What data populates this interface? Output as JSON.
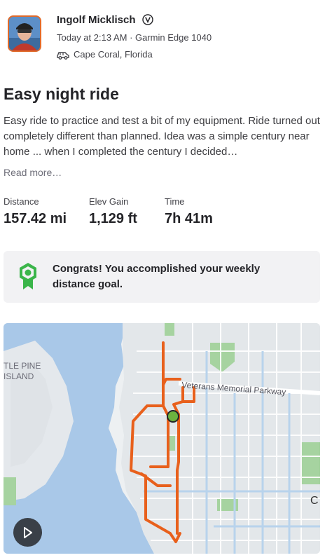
{
  "header": {
    "athlete_name": "Ingolf Micklisch",
    "verified_glyph": "Ⓥ",
    "meta": "Today at 2:13 AM · Garmin Edge 1040",
    "location": "Cape Coral, Florida",
    "location_icon": "car-icon",
    "avatar_icon": "avatar"
  },
  "activity": {
    "title": "Easy night ride",
    "description": "Easy ride to practice and test a bit of my equipment. Ride turned out completely different than planned. Idea was a simple century near home ... when I completed the century I decided…",
    "read_more": "Read more…"
  },
  "stats": [
    {
      "label": "Distance",
      "value": "157.42 mi"
    },
    {
      "label": "Elev Gain",
      "value": "1,129 ft"
    },
    {
      "label": "Time",
      "value": "7h 41m"
    }
  ],
  "goal": {
    "text": "Congrats! You accomplished your weekly distance goal.",
    "icon": "badge-icon",
    "accent": "#3bb54a"
  },
  "map": {
    "labels": {
      "island_line1": "TLE PINE",
      "island_line2": "ISLAND",
      "parkway": "Veterans Memorial Parkway",
      "edge_letter": "C"
    },
    "route_color": "#e8601c",
    "start_marker_color": "#6cb33f",
    "water_color": "#a9c8e8"
  },
  "controls": {
    "play_icon": "play-icon"
  }
}
